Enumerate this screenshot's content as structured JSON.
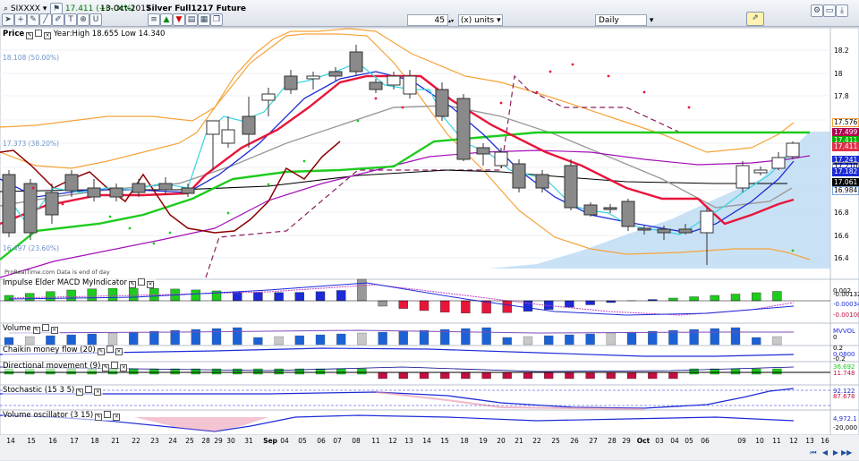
{
  "toolbar": {
    "symbol": "SIXXXX",
    "quote": "17.411 (+0.04%)",
    "date": "13-Oct-2017",
    "instrument": "Silver Full1217 Future",
    "units_value": "45",
    "units_label": "(x) units",
    "period": "Daily",
    "icons": [
      "cursor-icon",
      "crosshair-icon",
      "pencil-icon",
      "line-icon",
      "eraser-icon",
      "text-icon",
      "zoom-icon",
      "magnet-icon",
      "fibonacci-icon",
      "arrow-up-icon",
      "arrow-down-icon",
      "stack-icon",
      "grid-icon",
      "copy-icon",
      "settings-icon",
      "screen-icon",
      "export-icon",
      "close-icon"
    ]
  },
  "price_pane": {
    "title": "Price",
    "year_range": "Year:High 18.655 Low 14.340",
    "watermark": "ProRealTime.com Data is end of day",
    "fib_labels": [
      "18.108 (50.00%)",
      "17.373 (38.20%)",
      "16.497 (23.60%)"
    ],
    "axis_ticks": [
      "18.2",
      "18",
      "17.8",
      "17.6",
      "17.4",
      "17.2",
      "17",
      "16.8",
      "16.6",
      "16.4"
    ],
    "value_tags": [
      {
        "text": "17.576",
        "color": "#f2a23c"
      },
      {
        "text": "17.499",
        "color": "#b0004f"
      },
      {
        "text": "17.411",
        "color": "#00b000"
      },
      {
        "text": "17.411",
        "color": "#e0304a"
      },
      {
        "text": "17.241",
        "color": "#1c2bd6"
      },
      {
        "text": "17.210",
        "color": "#9a9a9a"
      },
      {
        "text": "17.182",
        "color": "#1c2bd6"
      },
      {
        "text": "17.061",
        "color": "#000000"
      },
      {
        "text": "16.984",
        "color": "#7aa3d6"
      }
    ]
  },
  "indicators": [
    {
      "title": "Impulse Elder MACD MyIndicator",
      "ticks": [
        "0.002",
        "-0.00132",
        "-0.00034",
        "-0.00100"
      ]
    },
    {
      "title": "Volume",
      "ticks": [
        "0",
        "MVVOL"
      ]
    },
    {
      "title": "Chaikin money flow (20)",
      "ticks": [
        "0.2",
        "0.0800",
        "-0.2"
      ]
    },
    {
      "title": "Directional movement (9)",
      "ticks": [
        "36.692",
        "11.748"
      ]
    },
    {
      "title": "Stochastic (15 3 5)",
      "ticks": [
        "92.122",
        "87.678"
      ]
    },
    {
      "title": "Volume oscillator (3 15)",
      "ticks": [
        "4,972.1",
        "-20,000"
      ]
    }
  ],
  "x_axis": {
    "labels": [
      "14",
      "15",
      "16",
      "17",
      "18",
      "21",
      "22",
      "23",
      "24",
      "25",
      "28",
      "29",
      "30",
      "31",
      "Sep",
      "04",
      "05",
      "06",
      "07",
      "08",
      "11",
      "12",
      "13",
      "14",
      "15",
      "18",
      "19",
      "20",
      "21",
      "22",
      "25",
      "26",
      "27",
      "28",
      "29",
      "Oct",
      "03",
      "04",
      "05",
      "06",
      "09",
      "10",
      "11",
      "12",
      "13",
      "16",
      "17"
    ]
  },
  "nav_icons": [
    "nav-first-icon",
    "nav-prev-icon",
    "nav-play-icon",
    "nav-next-icon",
    "nav-last-icon"
  ]
}
